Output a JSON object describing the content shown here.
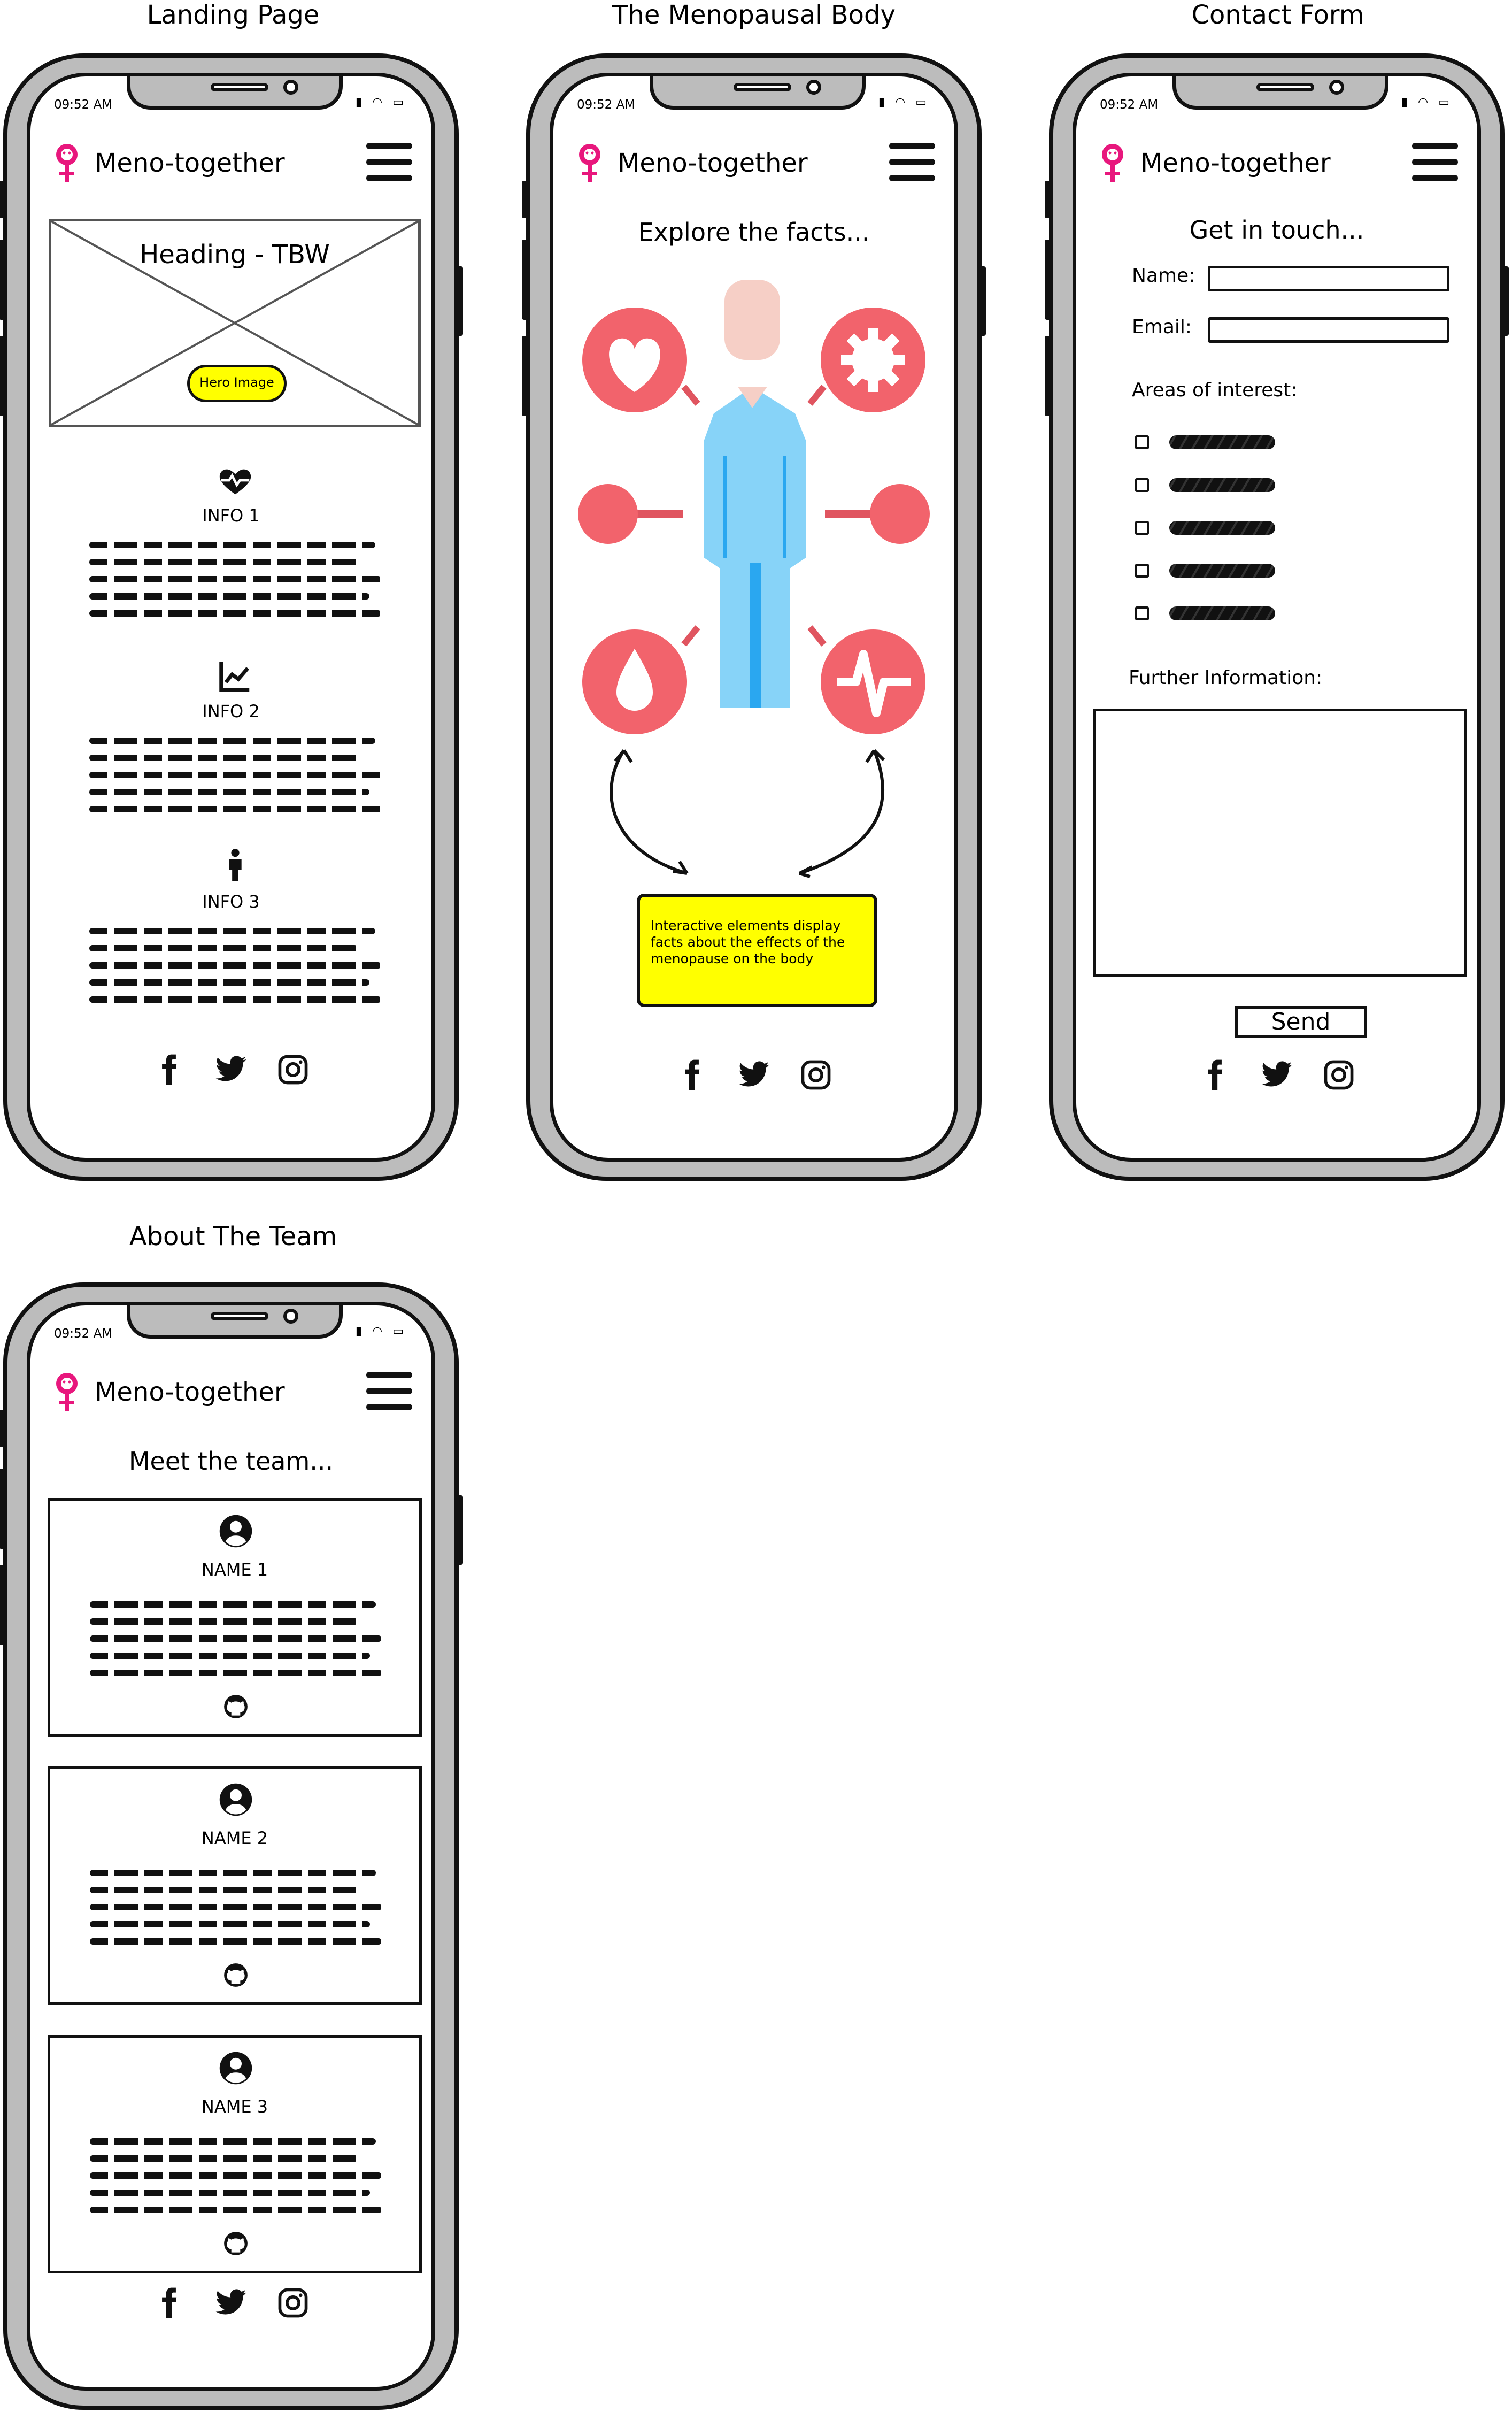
{
  "captions": {
    "landing": "Landing Page",
    "body": "The Menopausal Body",
    "contact": "Contact Form",
    "about": "About The Team"
  },
  "status_bar": {
    "time": "09:52 AM"
  },
  "app_bar": {
    "title": "Meno-together",
    "logo_icon": "female-symbol-icon",
    "menu_icon": "hamburger-menu-icon"
  },
  "colors": {
    "brand_pink": "#e8177d",
    "highlight_yellow": "#ffff00",
    "body_red": "#f2636c",
    "body_blue": "#87d3f8"
  },
  "landing": {
    "hero_heading": "Heading - TBW",
    "hero_image_label": "Hero Image",
    "info_items": [
      {
        "icon": "heart-pulse-icon",
        "label": "INFO 1"
      },
      {
        "icon": "line-chart-icon",
        "label": "INFO 2"
      },
      {
        "icon": "person-icon",
        "label": "INFO 3"
      }
    ]
  },
  "body_page": {
    "title": "Explore the facts...",
    "note": "Interactive elements display facts about the effects of the menopause on the body"
  },
  "contact": {
    "title": "Get in touch...",
    "name_label": "Name:",
    "email_label": "Email:",
    "interests_label": "Areas of interest:",
    "further_label": "Further Information:",
    "send_label": "Send"
  },
  "about": {
    "title": "Meet the team...",
    "members": [
      {
        "name": "NAME 1",
        "icon": "account-circle-icon",
        "link_icon": "github-icon"
      },
      {
        "name": "NAME 2",
        "icon": "account-circle-icon",
        "link_icon": "github-icon"
      },
      {
        "name": "NAME 3",
        "icon": "account-circle-icon",
        "link_icon": "github-icon"
      }
    ]
  },
  "footer": {
    "social_icons": [
      "facebook-icon",
      "twitter-icon",
      "instagram-icon"
    ]
  }
}
